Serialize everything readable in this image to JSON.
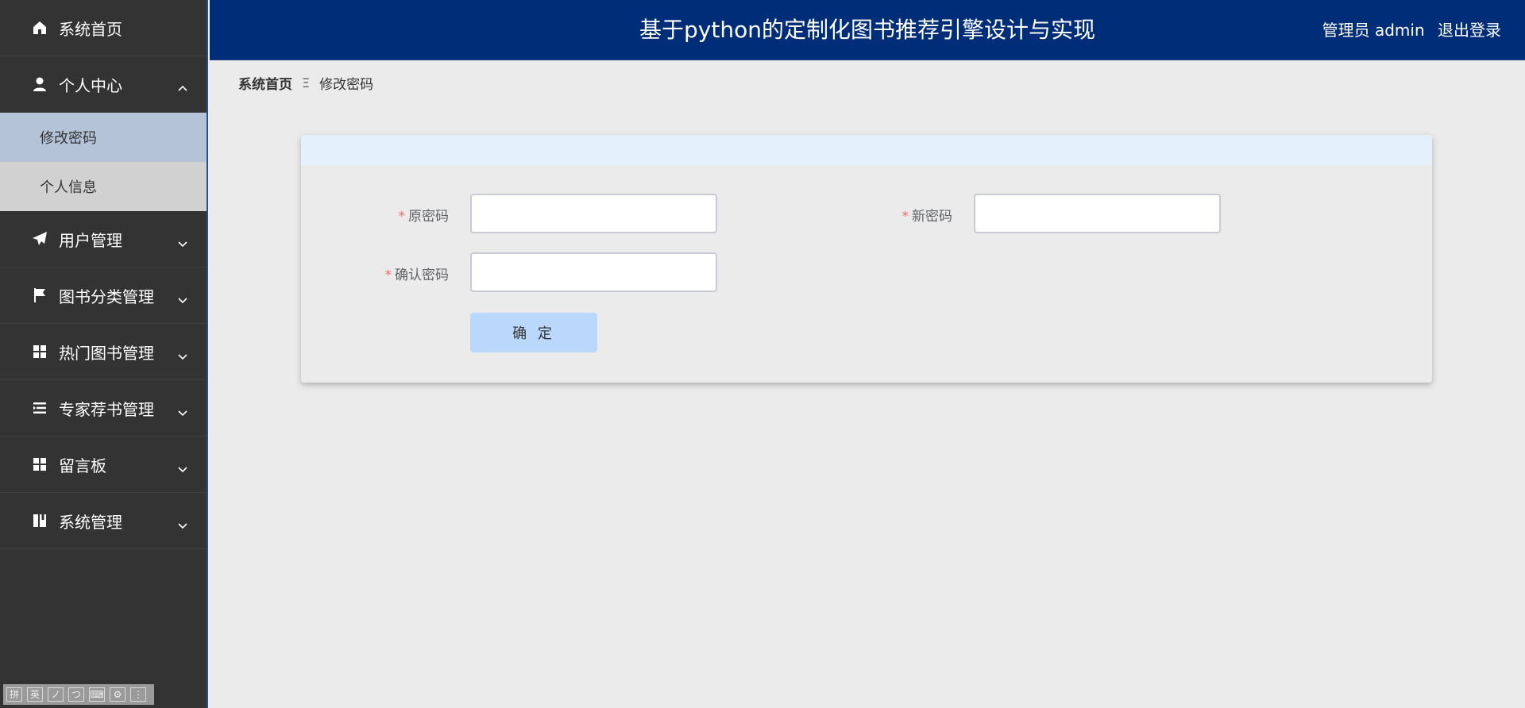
{
  "header": {
    "title": "基于python的定制化图书推荐引擎设计与实现",
    "role_label": "管理员 admin",
    "logout_label": "退出登录"
  },
  "sidebar": {
    "items": [
      {
        "label": "系统首页",
        "icon": "home-icon"
      },
      {
        "label": "个人中心",
        "icon": "user-icon",
        "expanded": true,
        "children": [
          {
            "label": "修改密码",
            "active": true
          },
          {
            "label": "个人信息",
            "active": false
          }
        ]
      },
      {
        "label": "用户管理",
        "icon": "send-icon"
      },
      {
        "label": "图书分类管理",
        "icon": "flag-icon"
      },
      {
        "label": "热门图书管理",
        "icon": "grid-icon"
      },
      {
        "label": "专家荐书管理",
        "icon": "list-icon"
      },
      {
        "label": "留言板",
        "icon": "grid-icon"
      },
      {
        "label": "系统管理",
        "icon": "book-icon"
      }
    ]
  },
  "breadcrumb": {
    "home": "系统首页",
    "separator": "Ξ",
    "current": "修改密码"
  },
  "form": {
    "required_mark": "*",
    "old_password_label": "原密码",
    "new_password_label": "新密码",
    "confirm_password_label": "确认密码",
    "old_password_value": "",
    "new_password_value": "",
    "confirm_password_value": "",
    "submit_label": "确 定"
  },
  "ime_toolbar": {
    "keys": [
      "拼",
      "英",
      "ノ",
      "つ",
      "⌨",
      "⚙",
      "⋮"
    ]
  },
  "colors": {
    "header_bg": "#002d78",
    "sidebar_bg": "#333333",
    "submenu_active_bg": "#b5c3d9",
    "required": "#f56c6c",
    "button_bg": "#b9d8fc"
  }
}
